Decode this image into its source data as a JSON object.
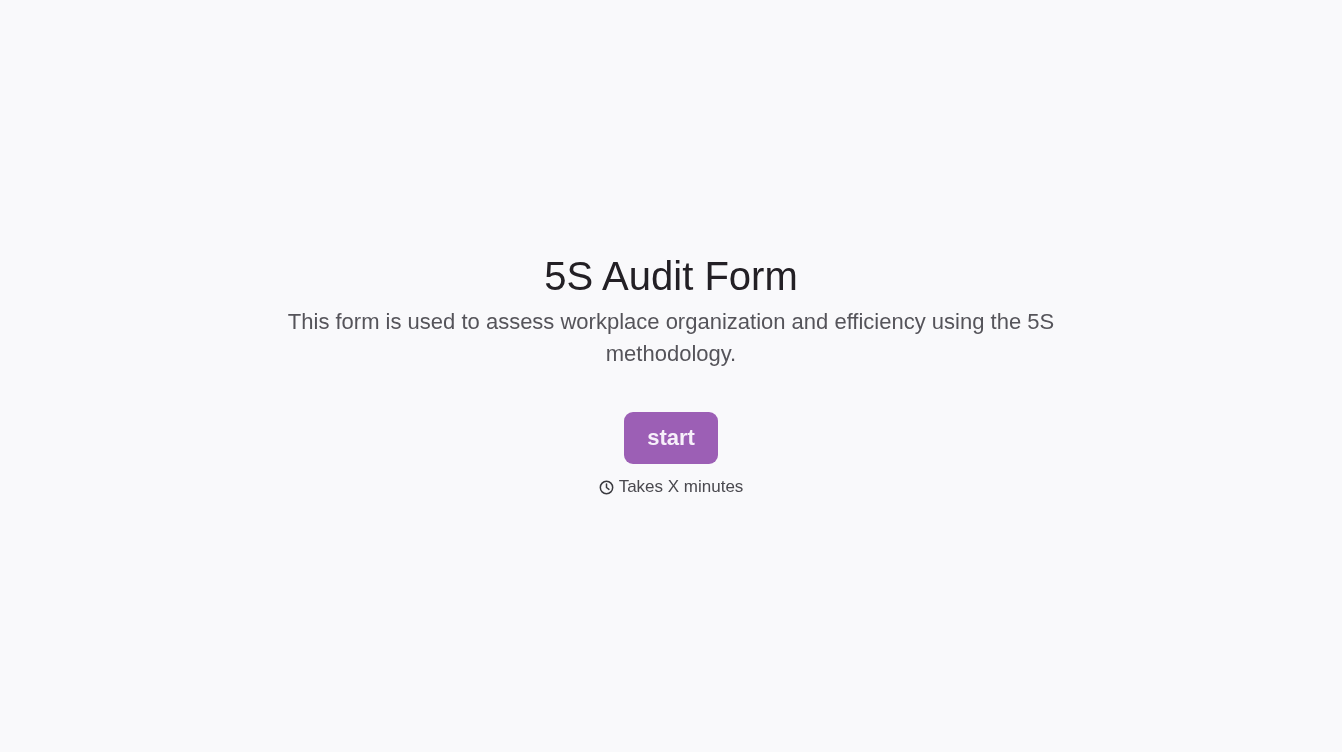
{
  "form": {
    "title": "5S Audit Form",
    "description": "This form is used to assess workplace organization and efficiency using the 5S methodology.",
    "start_button": "start",
    "duration": "Takes X minutes"
  }
}
